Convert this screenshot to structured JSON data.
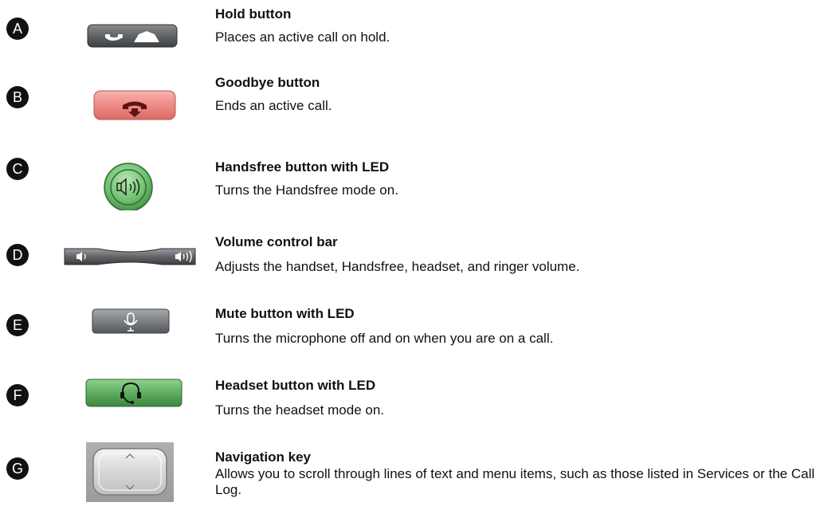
{
  "items": [
    {
      "letter": "A",
      "title": "Hold button",
      "desc": "Places an active call on hold."
    },
    {
      "letter": "B",
      "title": "Goodbye button",
      "desc": "Ends an active call."
    },
    {
      "letter": "C",
      "title": "Handsfree button with LED",
      "desc": "Turns the Handsfree mode on."
    },
    {
      "letter": "D",
      "title": "Volume control bar",
      "desc": "Adjusts the handset, Handsfree, headset, and ringer volume."
    },
    {
      "letter": "E",
      "title": "Mute button with LED",
      "desc": "Turns the microphone off and on when you are on a call."
    },
    {
      "letter": "F",
      "title": "Headset button with LED",
      "desc": "Turns the headset mode on."
    },
    {
      "letter": "G",
      "title": "Navigation key",
      "desc": "Allows you to scroll through lines of text and menu items, such as those listed in Services or the Call Log."
    }
  ],
  "icons": [
    "hold-icon",
    "goodbye-icon",
    "speaker-icon",
    "volume-bar-icon",
    "microphone-icon",
    "headset-icon",
    "navigation-key-icon"
  ],
  "colors": {
    "hold": "#5f6366",
    "goodbye": "#ef8a84",
    "handsfree": "#6fc070",
    "mute": "#7d8084",
    "headset": "#5fae5f",
    "nav": "#cfd1cf"
  }
}
